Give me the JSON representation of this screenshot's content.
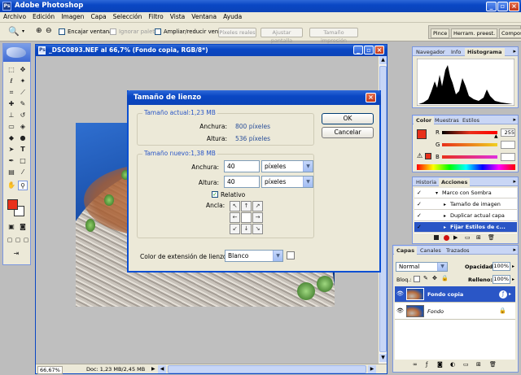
{
  "app": {
    "title": "Adobe Photoshop"
  },
  "menu": [
    "Archivo",
    "Edición",
    "Imagen",
    "Capa",
    "Selección",
    "Filtro",
    "Vista",
    "Ventana",
    "Ayuda"
  ],
  "options": {
    "encajar": "Encajar ventana",
    "ignorar": "Ignorar paletas",
    "ampliar": "Ampliar/reducir vent.",
    "pixeles_reales": "Píxeles reales",
    "ajustar": "Ajustar pantalla",
    "tamano_impresion": "Tamaño impresión"
  },
  "well_tabs": [
    "Pince",
    "Herram. preest.",
    "Compos"
  ],
  "document": {
    "title": "_DSC0893.NEF al 66,7% (Fondo copia, RGB/8*)",
    "zoom": "66,67%",
    "doc_info": "Doc: 1,23 MB/2,45 MB"
  },
  "dialog": {
    "title": "Tamaño de lienzo",
    "current_group": "Tamaño actual:1,23 MB",
    "width_label": "Anchura:",
    "height_label": "Altura:",
    "current_width": "800 píxeles",
    "current_height": "536 píxeles",
    "new_group": "Tamaño nuevo:1,38 MB",
    "new_width": "40",
    "new_height": "40",
    "unit_width": "píxeles",
    "unit_height": "píxeles",
    "relative_label": "Relativo",
    "anchor_label": "Ancla:",
    "ext_color_label": "Color de extensión de lienzo:",
    "ext_color_value": "Blanco",
    "ok": "OK",
    "cancel": "Cancelar"
  },
  "nav_panel": {
    "tabs": [
      "Navegador",
      "Info",
      "Histograma"
    ]
  },
  "color_panel": {
    "tabs": [
      "Color",
      "Muestras",
      "Estilos"
    ],
    "labels": [
      "R",
      "G",
      "B"
    ],
    "values": [
      "255",
      "",
      ""
    ]
  },
  "actions_panel": {
    "tabs": [
      "Historia",
      "Acciones"
    ],
    "items": [
      "Marco con Sombra",
      "Tamaño de imagen",
      "Duplicar actual capa",
      "Fijar Estilos de c..."
    ]
  },
  "layers_panel": {
    "tabs": [
      "Capas",
      "Canales",
      "Trazados"
    ],
    "blend": "Normal",
    "opacity_label": "Opacidad:",
    "opacity": "100%",
    "lock_label": "Bloq.:",
    "fill_label": "Relleno:",
    "fill": "100%",
    "layers": [
      "Fondo copia",
      "Fondo"
    ]
  },
  "colors": {
    "foreground": "#e8301a",
    "background": "#ffffff",
    "titlebar": "#0a47c4"
  }
}
